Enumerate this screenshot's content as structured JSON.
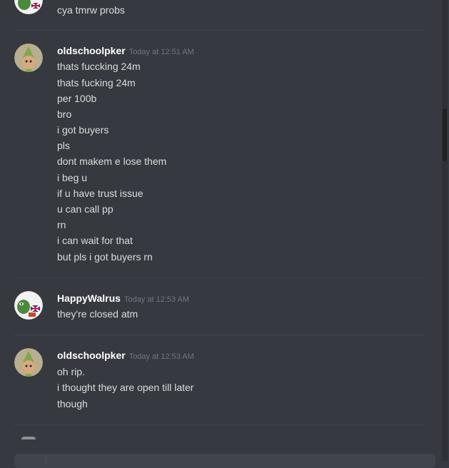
{
  "top_message": {
    "lines": [
      "cya tmrw probs"
    ]
  },
  "messages": [
    {
      "username": "oldschoolpker",
      "timestamp": "Today at 12:51 AM",
      "avatar_icon": "gnome-child-icon",
      "lines": [
        "thats fuccking 24m",
        "thats fucking 24m",
        "per 100b",
        "bro",
        "i got buyers",
        "pls",
        "dont makem e lose them",
        "i beg u",
        "if u have trust issue",
        "u can call pp",
        "rn",
        "i can wait for that",
        "but pls i got buyers rn"
      ]
    },
    {
      "username": "HappyWalrus",
      "timestamp": "Today at 12:53 AM",
      "avatar_icon": "pepe-frog-flag-icon",
      "lines": [
        "they're closed atm"
      ]
    },
    {
      "username": "oldschoolpker",
      "timestamp": "Today at 12:53 AM",
      "avatar_icon": "gnome-child-icon",
      "lines": [
        "oh rip.",
        "i thought they are open till later",
        "though"
      ]
    }
  ],
  "colors": {
    "background": "#36393f",
    "username": "#ffffff",
    "text": "#dcddde",
    "timestamp": "#72767d",
    "divider": "#42454a"
  }
}
